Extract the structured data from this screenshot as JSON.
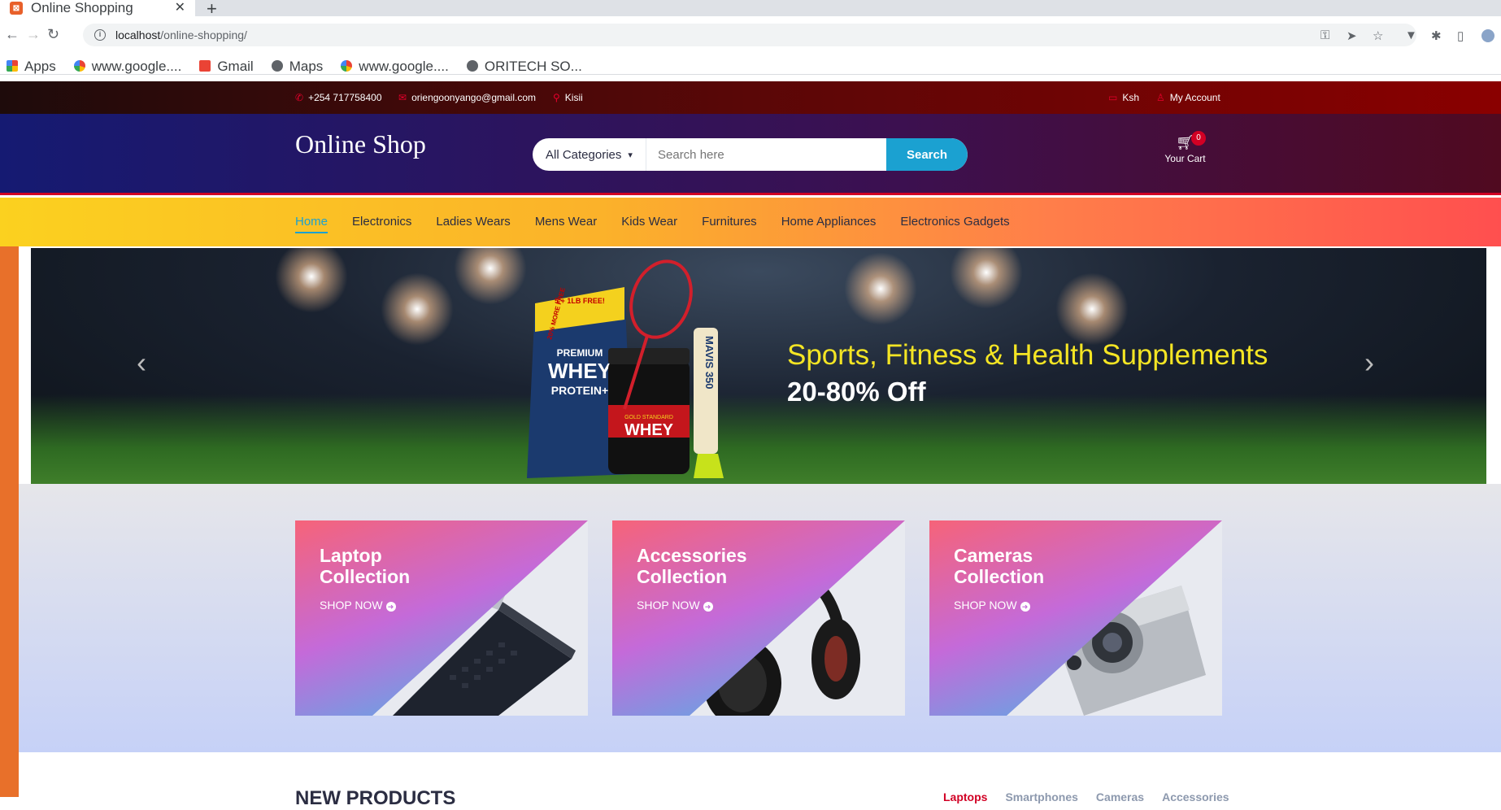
{
  "browser": {
    "tab_title": "Online Shopping",
    "url_host": "localhost",
    "url_path": "/online-shopping/",
    "bookmarks": [
      {
        "label": "Apps",
        "icon": "apps-grid-icon"
      },
      {
        "label": "www.google....",
        "icon": "google-icon"
      },
      {
        "label": "Gmail",
        "icon": "gmail-icon"
      },
      {
        "label": "Maps",
        "icon": "globe-icon"
      },
      {
        "label": "www.google....",
        "icon": "google-icon"
      },
      {
        "label": "ORITECH SO...",
        "icon": "globe-icon"
      }
    ]
  },
  "topbar": {
    "phone": "+254 717758400",
    "email": "oriengoonyango@gmail.com",
    "location": "Kisii",
    "currency": "Ksh",
    "account": "My Account"
  },
  "header": {
    "logo": "Online Shop",
    "category_selected": "All Categories",
    "search_placeholder": "Search here",
    "search_button": "Search",
    "cart_label": "Your Cart",
    "cart_qty": "0"
  },
  "nav": {
    "items": [
      "Home",
      "Electronics",
      "Ladies Wears",
      "Mens Wear",
      "Kids Wear",
      "Furnitures",
      "Home Appliances",
      "Electronics Gadgets"
    ],
    "active": "Home"
  },
  "hero": {
    "headline": "Sports, Fitness & Health Supplements",
    "offer": "20-80% Off",
    "product_text": [
      "PREMIUM",
      "WHEY",
      "PROTEIN+",
      "20% MORE FREE",
      "5 + 1LB FREE!",
      "WHEY",
      "GOLD STANDARD",
      "MAVIS 350"
    ]
  },
  "collections": [
    {
      "line1": "Laptop",
      "line2": "Collection",
      "cta": "SHOP NOW"
    },
    {
      "line1": "Accessories",
      "line2": "Collection",
      "cta": "SHOP NOW"
    },
    {
      "line1": "Cameras",
      "line2": "Collection",
      "cta": "SHOP NOW"
    }
  ],
  "new_products": {
    "title": "NEW PRODUCTS",
    "tabs": [
      "Laptops",
      "Smartphones",
      "Cameras",
      "Accessories"
    ]
  },
  "colors": {
    "accent": "#d10024",
    "search": "#1ba1d1",
    "headline": "#f4e524"
  }
}
